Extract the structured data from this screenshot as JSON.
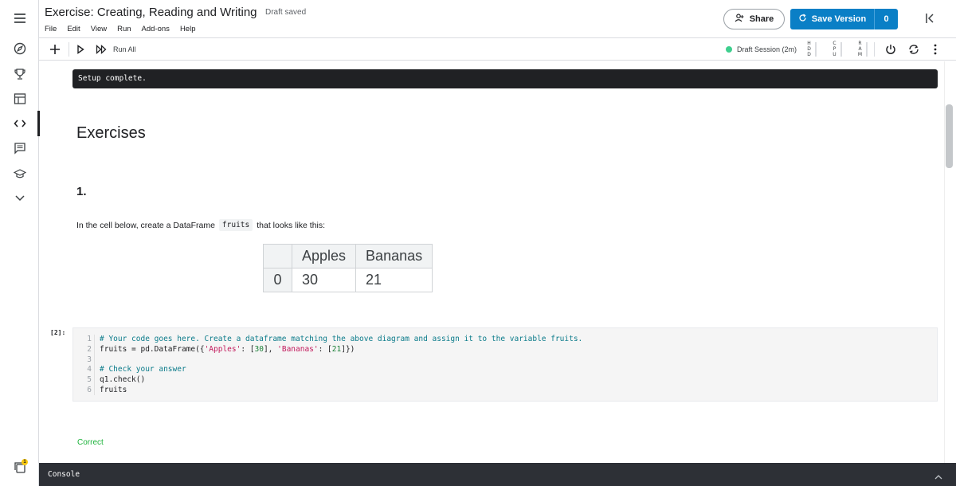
{
  "header": {
    "title": "Exercise: Creating, Reading and Writing",
    "draft_status": "Draft saved",
    "menu": [
      "File",
      "Edit",
      "View",
      "Run",
      "Add-ons",
      "Help"
    ],
    "share_label": "Share",
    "save_version_label": "Save Version",
    "save_version_count": "0"
  },
  "toolbar": {
    "run_all_label": "Run All",
    "session_label": "Draft Session (2m)",
    "session_color": "#3ecf8e",
    "meters": {
      "hdd": [
        "H",
        "D",
        "D"
      ],
      "cpu": [
        "C",
        "P",
        "U"
      ],
      "ram": [
        "R",
        "A",
        "M"
      ]
    }
  },
  "sidebar": {
    "icons": [
      "menu-icon",
      "compass-icon",
      "trophy-icon",
      "table-icon",
      "code-icon",
      "comments-icon",
      "school-icon",
      "chevron-down-icon"
    ],
    "active": "code-icon",
    "notification_badge": "1"
  },
  "notebook": {
    "setup_output": "Setup complete.",
    "heading": "Exercises",
    "question_number": "1.",
    "instruction_before": "In the cell below, create a DataFrame",
    "instruction_code": "fruits",
    "instruction_after": "that looks like this:",
    "dataframe": {
      "columns": [
        "Apples",
        "Bananas"
      ],
      "rows": [
        {
          "index": "0",
          "values": [
            "30",
            "21"
          ]
        }
      ]
    },
    "cell_label": "[2]:",
    "code_line_numbers": [
      "1",
      "2",
      "3",
      "4",
      "5",
      "6"
    ],
    "code": {
      "line1": "# Your code goes here. Create a dataframe matching the above diagram and assign it to the variable fruits.",
      "line2_a": "fruits = pd.DataFrame({",
      "line2_s1": "'Apples'",
      "line2_b": ": [",
      "line2_n1": "30",
      "line2_c": "], ",
      "line2_s2": "'Bananas'",
      "line2_d": ": [",
      "line2_n2": "21",
      "line2_e": "]})",
      "line4": "# Check your answer",
      "line5": "q1.check()",
      "line6": "fruits"
    },
    "result": "Correct",
    "result_color": "#1eb33c"
  },
  "console": {
    "label": "Console"
  }
}
